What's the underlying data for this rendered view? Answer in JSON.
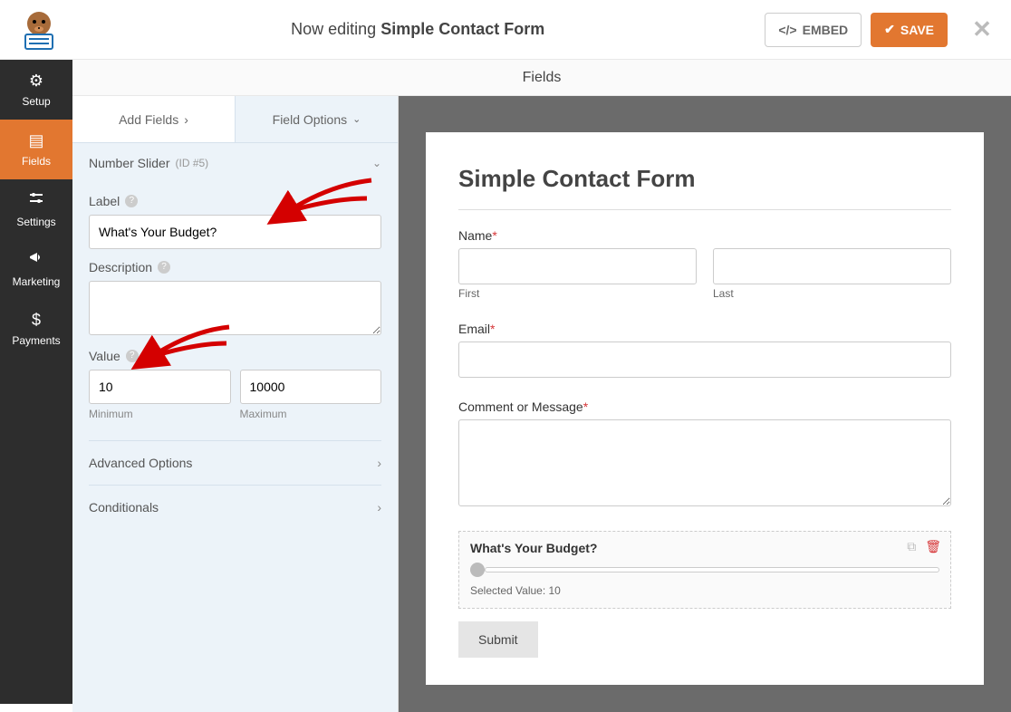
{
  "topbar": {
    "editing_prefix": "Now editing ",
    "form_name": "Simple Contact Form",
    "embed_label": "EMBED",
    "save_label": "SAVE"
  },
  "sidenav": {
    "setup": "Setup",
    "fields": "Fields",
    "settings": "Settings",
    "marketing": "Marketing",
    "payments": "Payments"
  },
  "subheader": "Fields",
  "tabs": {
    "add_fields": "Add Fields",
    "field_options": "Field Options"
  },
  "field_header": {
    "name": "Number Slider",
    "id": "(ID #5)"
  },
  "options": {
    "label_label": "Label",
    "label_value": "What's Your Budget?",
    "desc_label": "Description",
    "desc_value": "",
    "value_label": "Value",
    "min_value": "10",
    "min_sub": "Minimum",
    "max_value": "10000",
    "max_sub": "Maximum",
    "advanced": "Advanced Options",
    "conditionals": "Conditionals"
  },
  "form": {
    "title": "Simple Contact Form",
    "name_label": "Name",
    "first_sub": "First",
    "last_sub": "Last",
    "email_label": "Email",
    "comment_label": "Comment or Message",
    "budget_label": "What's Your Budget?",
    "selected_value_text": "Selected Value: 10",
    "submit": "Submit"
  }
}
